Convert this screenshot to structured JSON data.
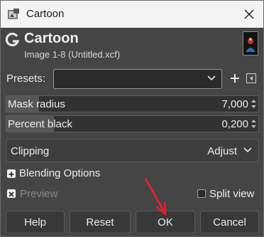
{
  "window": {
    "title": "Cartoon"
  },
  "header": {
    "title": "Cartoon",
    "subtitle": "Image 1-8 (Untitled.xcf)"
  },
  "presets": {
    "label": "Presets:",
    "value": ""
  },
  "mask_radius": {
    "label": "Mask radius",
    "value": "7,000",
    "fill_fraction": 0.13
  },
  "percent_black": {
    "label": "Percent black",
    "value": "0,200",
    "fill_fraction": 0.19
  },
  "clipping": {
    "label": "Clipping",
    "value": "Adjust"
  },
  "blending": {
    "label": "Blending Options"
  },
  "preview": {
    "label": "Preview",
    "checked": true,
    "enabled": false
  },
  "split_view": {
    "label": "Split view",
    "checked": false
  },
  "buttons": {
    "help": "Help",
    "reset": "Reset",
    "ok": "OK",
    "cancel": "Cancel"
  },
  "colors": {
    "dialog_bg": "#454545",
    "annotation_arrow": "#e8202a"
  }
}
